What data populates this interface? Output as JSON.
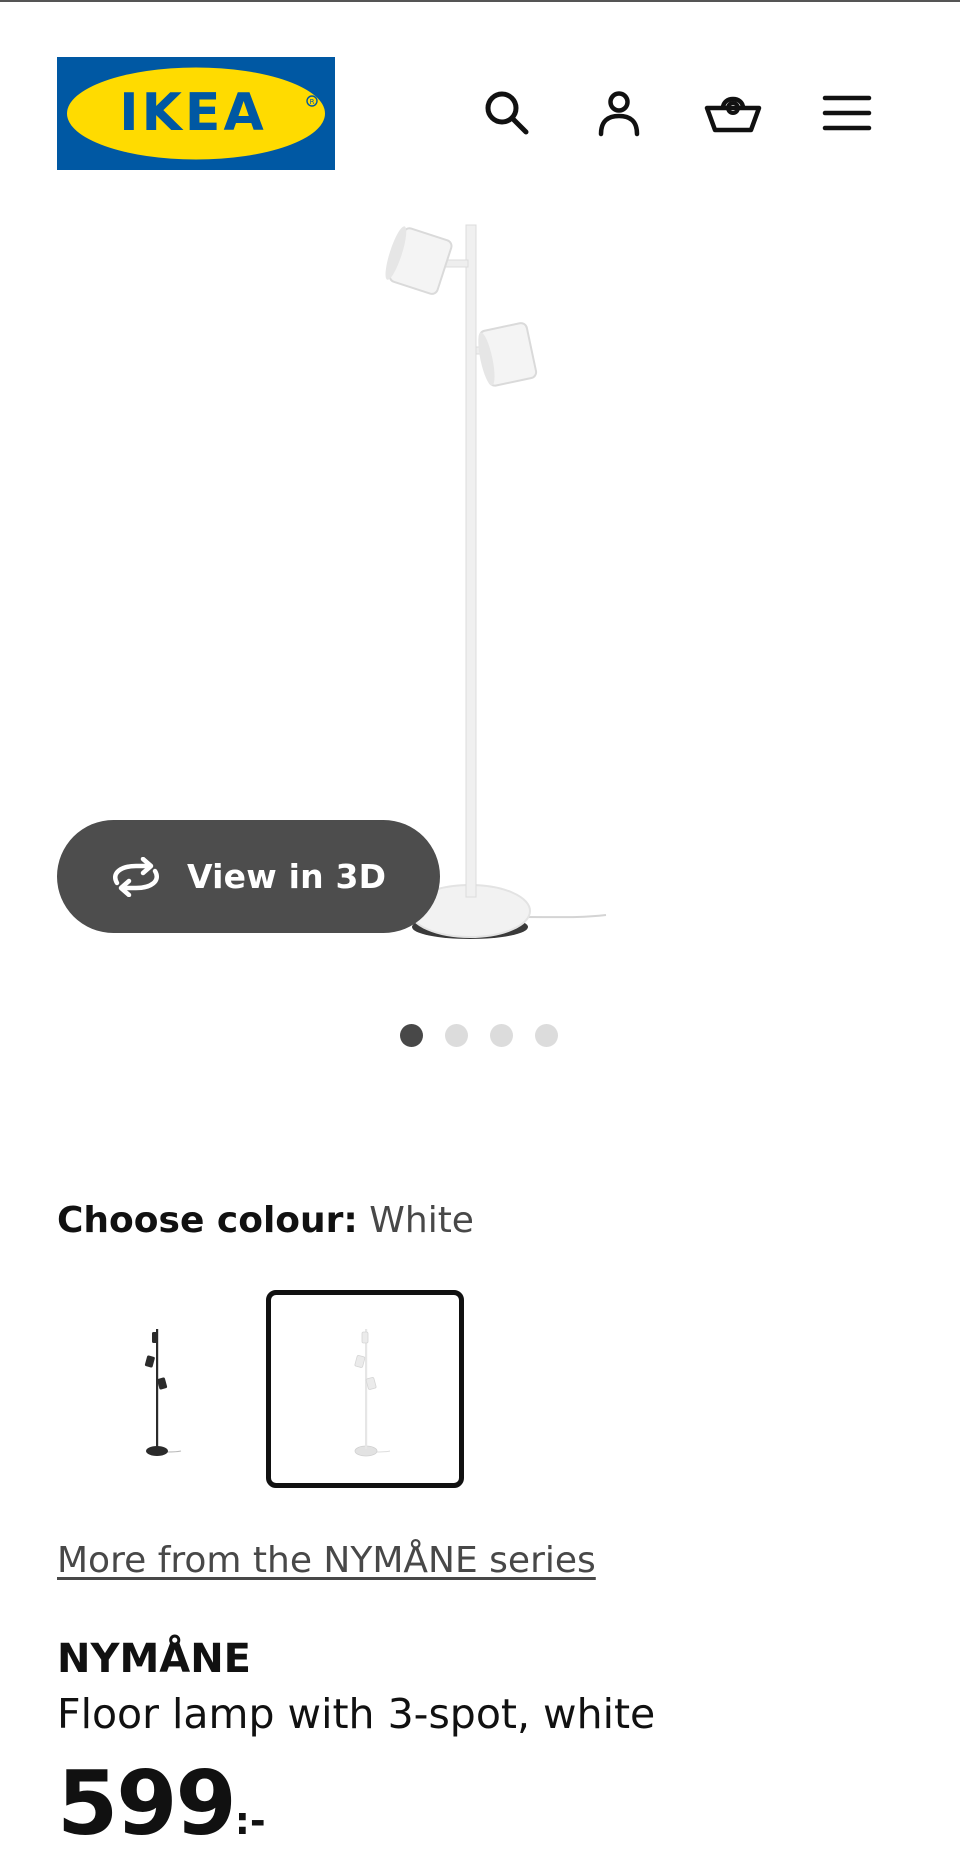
{
  "header": {
    "logo_text": "IKEA",
    "icons": [
      "search-icon",
      "user-icon",
      "basket-icon",
      "menu-icon"
    ]
  },
  "gallery": {
    "view_3d_label": "View in 3D",
    "slide_count": 4,
    "active_slide": 1
  },
  "colour": {
    "label": "Choose colour:",
    "selected": "White",
    "options": [
      "Black",
      "White"
    ]
  },
  "series_link": "More from the NYMÅNE series",
  "product": {
    "name": "NYMÅNE",
    "description": "Floor lamp with 3-spot, white",
    "price": "599",
    "price_suffix": ":-"
  },
  "colors": {
    "brand_blue": "#0058a3",
    "brand_yellow": "#ffdb00",
    "button_dark": "#4d4d4d"
  }
}
